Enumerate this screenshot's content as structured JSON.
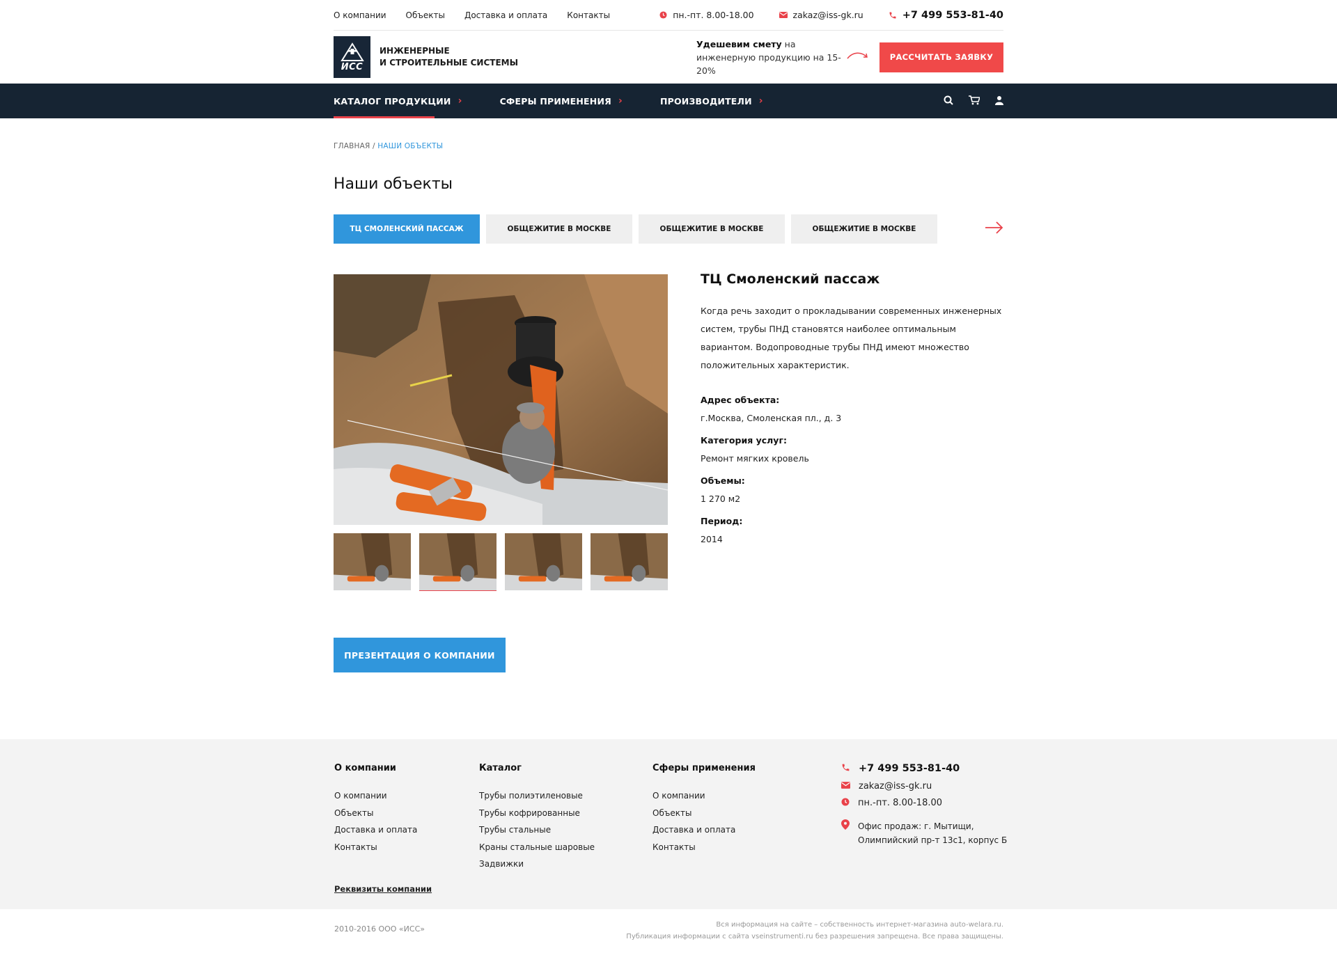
{
  "topbar": {
    "nav": [
      "О компании",
      "Объекты",
      "Доставка и оплата",
      "Контакты"
    ],
    "hours": "пн.-пт. 8.00-18.00",
    "email": "zakaz@iss-gk.ru",
    "phone": "+7 499 553-81-40"
  },
  "header": {
    "logo_text": "ИСС",
    "company_line1": "ИНЖЕНЕРНЫЕ",
    "company_line2": "И СТРОИТЕЛЬНЫЕ СИСТЕМЫ",
    "promo_bold": "Удешевим смету",
    "promo_rest": " на инженерную продукцию на 15-20%",
    "cta_label": "РАССЧИТАТЬ ЗАЯВКУ"
  },
  "mainnav": {
    "items": [
      "КАТАЛОГ ПРОДУКЦИИ",
      "СФЕРЫ ПРИМЕНЕНИЯ",
      "ПРОИЗВОДИТЕЛИ"
    ],
    "icons": [
      "search-icon",
      "cart-icon",
      "user-icon"
    ]
  },
  "breadcrumb": {
    "home": "ГЛАВНАЯ",
    "separator": " / ",
    "current": "НАШИ ОБЪЕКТЫ"
  },
  "page": {
    "title": "Наши объекты",
    "tabs": [
      "ТЦ СМОЛЕНСКИЙ ПАССАЖ",
      "ОБЩЕЖИТИЕ В МОСКВЕ",
      "ОБЩЕЖИТИЕ В МОСКВЕ",
      "ОБЩЕЖИТИЕ В МОСКВЕ"
    ],
    "active_tab": 0
  },
  "object": {
    "title": "ТЦ Смоленский пассаж",
    "description": "Когда речь заходит о прокладывании современных инженерных систем, трубы ПНД становятся наиболее оптимальным вариантом. Водопроводные трубы ПНД имеют множество положительных характеристик.",
    "address_label": "Адрес объекта:",
    "address": "г.Москва, Смоленская пл., д. 3",
    "category_label": "Категория услуг:",
    "category": "Ремонт мягких кровель",
    "volume_label": "Объемы:",
    "volume": "1 270 м2",
    "period_label": "Период:",
    "period": "2014",
    "active_thumb": 1
  },
  "presentation_label": "ПРЕЗЕНТАЦИЯ О КОМПАНИИ",
  "footer": {
    "col1_title": "О компании",
    "col1_items": [
      "О компании",
      "Объекты",
      "Доставка и оплата",
      "Контакты"
    ],
    "col2_title": "Каталог",
    "col2_items": [
      "Трубы полиэтиленовые",
      "Трубы кофрированные",
      "Трубы стальные",
      "Краны стальные шаровые",
      "Задвижки"
    ],
    "col3_title": "Сферы применения",
    "col3_items": [
      "О компании",
      "Объекты",
      "Доставка и оплата",
      "Контакты"
    ],
    "phone": "+7 499 553-81-40",
    "email": "zakaz@iss-gk.ru",
    "hours": "пн.-пт. 8.00-18.00",
    "address_line1": "Офис продаж: г. Мытищи,",
    "address_line2": "Олимпийский пр-т 13с1, корпус Б",
    "requisites": "Реквизиты компании"
  },
  "bottom": {
    "copyright": "2010-2016 ООО «ИСС»",
    "legal_line1": "Вся информация на сайте – собственность интернет-магазина auto-welara.ru.",
    "legal_line2": "Публикация информации с сайта vseinstrumenti.ru без разрешения запрещена. Все права защищены."
  },
  "colors": {
    "accent_red": "#e9424a",
    "accent_blue": "#3096dc",
    "nav_dark": "#162433"
  }
}
